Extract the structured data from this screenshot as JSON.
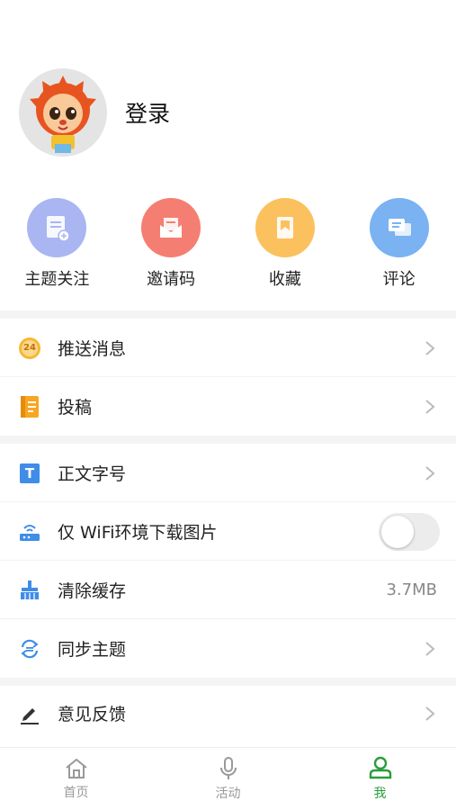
{
  "profile": {
    "login_label": "登录"
  },
  "actions": [
    {
      "label": "主题关注",
      "icon": "topic-follow-icon",
      "color": "#a9b6f2"
    },
    {
      "label": "邀请码",
      "icon": "invite-code-icon",
      "color": "#f57e72"
    },
    {
      "label": "收藏",
      "icon": "favorites-icon",
      "color": "#fbc15f"
    },
    {
      "label": "评论",
      "icon": "comment-icon",
      "color": "#7ab2f2"
    }
  ],
  "menu": {
    "push": {
      "label": "推送消息",
      "badge": "24"
    },
    "submit": {
      "label": "投稿"
    },
    "font_size": {
      "label": "正文字号",
      "icon_text": "T"
    },
    "wifi_only": {
      "label": "仅 WiFi环境下载图片",
      "enabled": false
    },
    "clear_cache": {
      "label": "清除缓存",
      "value": "3.7MB"
    },
    "sync_theme": {
      "label": "同步主题"
    },
    "feedback": {
      "label": "意见反馈"
    }
  },
  "nav": {
    "home": "首页",
    "activity": "活动",
    "me": "我"
  },
  "colors": {
    "accent": "#2a9d3a"
  }
}
